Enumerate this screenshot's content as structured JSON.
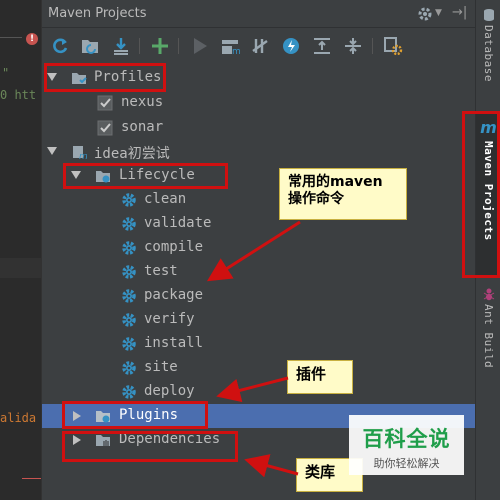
{
  "editor": {
    "fragments": [
      "\"",
      "0 htt",
      "alida"
    ]
  },
  "panel": {
    "title": "Maven Projects"
  },
  "toolbar": {
    "buttons": [
      {
        "name": "reimport-icon",
        "color": "#3592c4"
      },
      {
        "name": "generate-sources-icon",
        "color": "#3592c4"
      },
      {
        "name": "download-icon",
        "color": "#3592c4"
      },
      {
        "name": "add-maven-project-icon",
        "color": "#59a869"
      },
      {
        "name": "run-icon",
        "color": "#6f737a"
      },
      {
        "name": "run-maven-build-icon",
        "color": "#9aa7b0"
      },
      {
        "name": "toggle-offline-mode-icon",
        "color": "#9aa7b0"
      },
      {
        "name": "skip-tests-icon",
        "color": "#3592c4"
      },
      {
        "name": "show-dependencies-icon",
        "color": "#9aa7b0"
      },
      {
        "name": "collapse-all-icon",
        "color": "#9aa7b0"
      },
      {
        "name": "maven-settings-icon",
        "color": "#9aa7b0"
      }
    ]
  },
  "tree": {
    "profiles": "Profiles",
    "profile_items": [
      "nexus",
      "sonar"
    ],
    "project": "idea初尝试",
    "lifecycle": "Lifecycle",
    "lifecycle_items": [
      "clean",
      "validate",
      "compile",
      "test",
      "package",
      "verify",
      "install",
      "site",
      "deploy"
    ],
    "plugins": "Plugins",
    "dependencies": "Dependencies"
  },
  "right_strip": {
    "database": "Database",
    "maven_projects": "Maven Projects",
    "ant_build": "Ant Build"
  },
  "annotations": {
    "callout_commands": "常用的maven\n操作命令",
    "callout_plugins": "插件",
    "callout_libraries": "类库"
  },
  "watermark": {
    "big": "百科全说",
    "small": "助你轻松解决"
  },
  "colors": {
    "panel_bg": "#3c3f41",
    "selection": "#4b6eaf",
    "annotation_red": "#d01010",
    "callout_bg": "#fffbc8"
  }
}
